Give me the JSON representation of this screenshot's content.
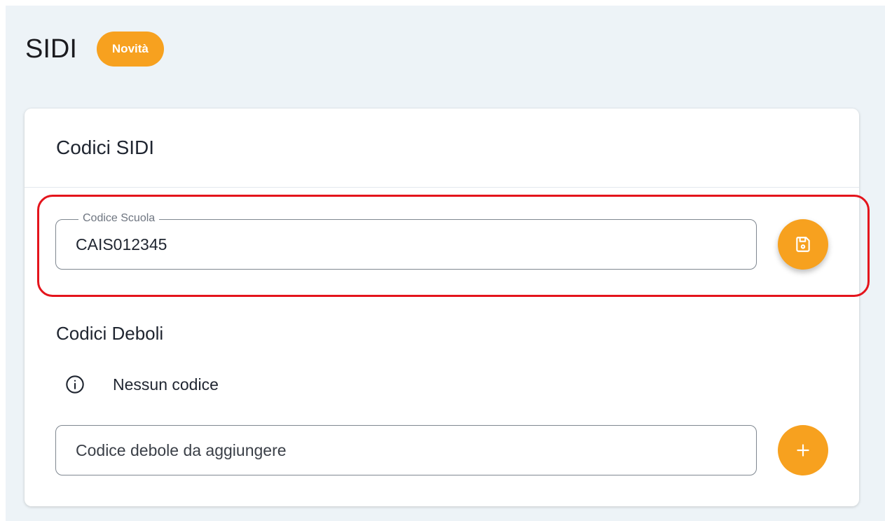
{
  "header": {
    "title": "SIDI",
    "badge": "Novità"
  },
  "card": {
    "title": "Codici SIDI",
    "school_code": {
      "label": "Codice Scuola",
      "value": "CAIS012345",
      "save_icon": "floppy-disk-icon"
    },
    "weak_codes": {
      "title": "Codici Deboli",
      "empty_message": "Nessun codice",
      "info_icon": "info-circle-icon",
      "placeholder": "Codice debole da aggiungere",
      "add_icon": "plus-icon"
    }
  },
  "colors": {
    "accent": "#f7a11f",
    "page_background": "#edf3f7",
    "highlight": "#e4141c"
  }
}
